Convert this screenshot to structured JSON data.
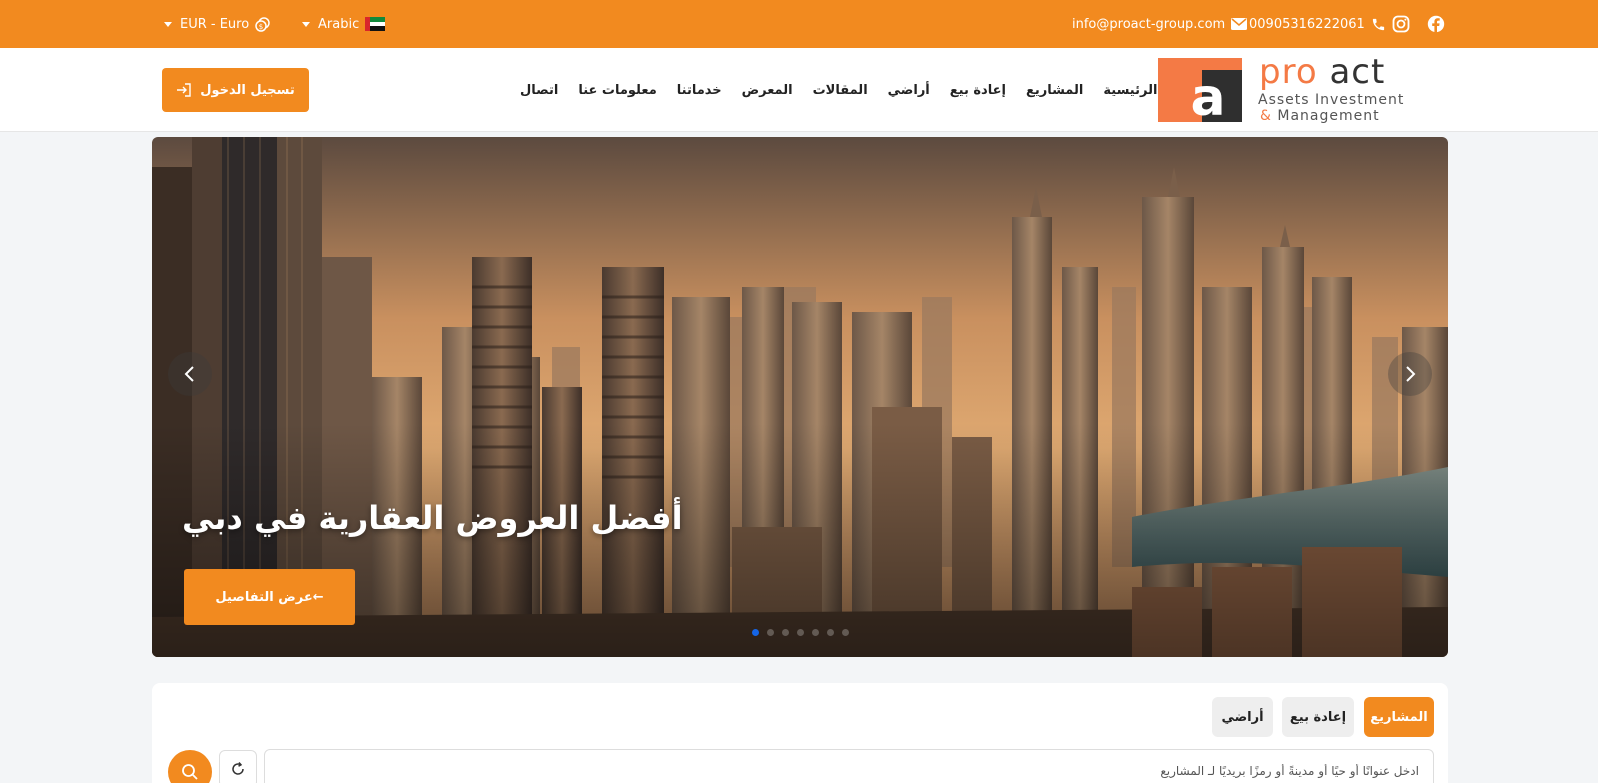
{
  "topbar": {
    "currency_label": "EUR - Euro",
    "language_label": "Arabic",
    "email": "info@proact-group.com",
    "phone": "00905316222061",
    "icons": [
      "coin-icon",
      "uae-flag-icon",
      "mail-icon",
      "phone-icon",
      "instagram-icon",
      "facebook-icon"
    ]
  },
  "header": {
    "login_label": "تسجيل الدخول",
    "nav": [
      "الرئيسية",
      "المشاريع",
      "إعادة بيع",
      "أراضي",
      "المقالات",
      "المعرض",
      "خدماتنا",
      "معلومات عنا",
      "اتصال"
    ],
    "logo": {
      "word1": "pro",
      "word2": "act",
      "line2": "Assets Investment",
      "amp": "&",
      "line3": "Management",
      "mark": "a"
    }
  },
  "hero": {
    "title": "أفضل العروض العقارية في دبي",
    "button_label": "عرض التفاصيل",
    "slide_count": 7,
    "active_slide": 1
  },
  "search": {
    "tabs": [
      "المشاريع",
      "إعادة بيع",
      "أراضي"
    ],
    "active_tab": 0,
    "placeholder": "ادخل عنوانًا أو حيًا أو مدينةً أو رمزًا بريديًا لـ المشاريع"
  },
  "colors": {
    "accent": "#f28a1f",
    "logo_orange": "#f47a45",
    "dot_active": "#1565e6"
  }
}
